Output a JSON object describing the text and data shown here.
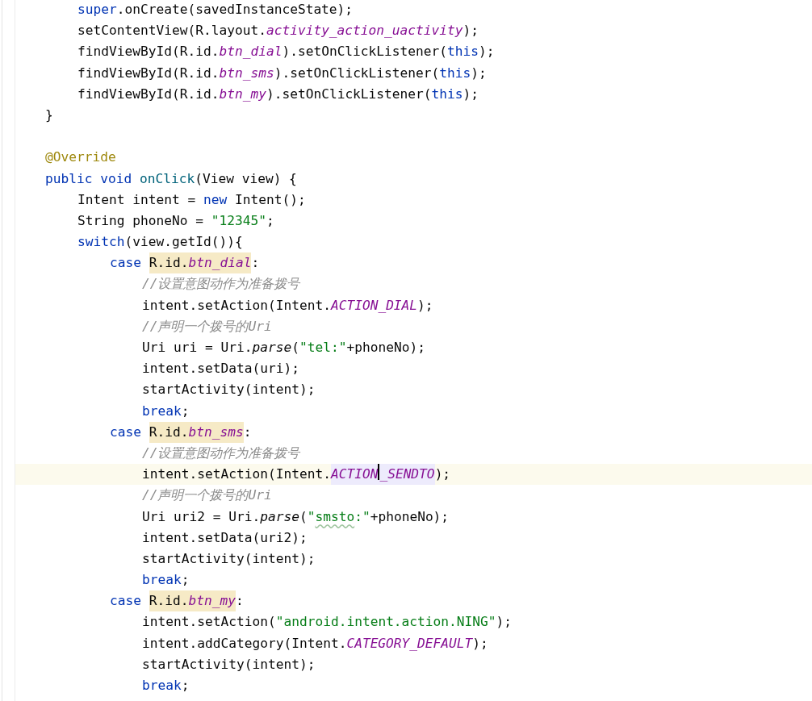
{
  "editor": {
    "lines": [
      {
        "children": [
          {
            "current": false,
            "tokens": [
              {
                "kind": "keyword",
                "text": "super"
              },
              {
                "kind": "plain",
                "text": ".onCreate(savedInstanceState);"
              }
            ]
          },
          {
            "current": false,
            "tokens": [
              {
                "kind": "plain",
                "text": "setContentView(R.layout."
              },
              {
                "kind": "constant",
                "text": "activity_action_uactivity"
              },
              {
                "kind": "plain",
                "text": ");"
              }
            ]
          },
          {
            "current": false,
            "tokens": [
              {
                "kind": "plain",
                "text": "findViewById(R.id."
              },
              {
                "kind": "constant",
                "text": "btn_dial"
              },
              {
                "kind": "plain",
                "text": ").setOnClickListener("
              },
              {
                "kind": "keyword",
                "text": "this"
              },
              {
                "kind": "plain",
                "text": ");"
              }
            ]
          },
          {
            "current": false,
            "tokens": [
              {
                "kind": "plain",
                "text": "findViewById(R.id."
              },
              {
                "kind": "constant",
                "text": "btn_sms"
              },
              {
                "kind": "plain",
                "text": ").setOnClickListener("
              },
              {
                "kind": "keyword",
                "text": "this"
              },
              {
                "kind": "plain",
                "text": ");"
              }
            ]
          },
          {
            "current": false,
            "tokens": [
              {
                "kind": "plain",
                "text": "findViewById(R.id."
              },
              {
                "kind": "constant",
                "text": "btn_my"
              },
              {
                "kind": "plain",
                "text": ").setOnClickListener("
              },
              {
                "kind": "keyword",
                "text": "this"
              },
              {
                "kind": "plain",
                "text": ");"
              }
            ]
          }
        ]
      },
      {
        "current": false,
        "tokens": [
          {
            "kind": "plain",
            "text": "}"
          }
        ]
      },
      {
        "current": false
      },
      {
        "current": false,
        "tokens": [
          {
            "kind": "annotation",
            "text": "@Override"
          }
        ]
      },
      {
        "current": false,
        "tokens": [
          {
            "kind": "keyword",
            "text": "public void"
          },
          {
            "kind": "method",
            "text": " onClick"
          },
          {
            "kind": "plain",
            "text": "(View view) {"
          }
        ],
        "children": [
          {
            "current": false,
            "tokens": [
              {
                "kind": "plain",
                "text": "Intent intent = "
              },
              {
                "kind": "keyword",
                "text": "new"
              },
              {
                "kind": "plain",
                "text": " Intent();"
              }
            ]
          },
          {
            "current": false,
            "tokens": [
              {
                "kind": "plain",
                "text": "String phoneNo = "
              },
              {
                "kind": "string",
                "text": "\"12345\""
              },
              {
                "kind": "plain",
                "text": ";"
              }
            ]
          },
          {
            "current": false,
            "tokens": [
              {
                "kind": "keyword",
                "text": "switch"
              },
              {
                "kind": "plain",
                "text": "(view.getId()){"
              }
            ],
            "children": [
              {
                "current": false,
                "tokens": [
                  {
                    "kind": "keyword",
                    "text": "case"
                  },
                  {
                    "kind": "usage",
                    "tokens": [
                      {
                        "kind": "plain",
                        "text": "R.id."
                      },
                      {
                        "kind": "constant",
                        "text": "btn_dial"
                      }
                    ]
                  },
                  {
                    "kind": "plain",
                    "text": ":"
                  }
                ],
                "children": [
                  {
                    "current": false,
                    "tokens": [
                      {
                        "kind": "comment",
                        "text": "//设置意图动作为准备拨号"
                      }
                    ]
                  },
                  {
                    "current": false,
                    "tokens": [
                      {
                        "kind": "plain",
                        "text": "intent.setAction(Intent."
                      },
                      {
                        "kind": "constant",
                        "text": "ACTION_DIAL"
                      },
                      {
                        "kind": "plain",
                        "text": ");"
                      }
                    ]
                  },
                  {
                    "current": false,
                    "tokens": [
                      {
                        "kind": "comment",
                        "text": "//声明一个拨号的Uri"
                      }
                    ]
                  },
                  {
                    "current": false,
                    "tokens": [
                      {
                        "kind": "plain",
                        "text": "Uri uri = Uri."
                      },
                      {
                        "kind": "static",
                        "text": "parse"
                      },
                      {
                        "kind": "plain",
                        "text": "("
                      },
                      {
                        "kind": "string",
                        "text": "\"tel:\""
                      },
                      {
                        "kind": "plain",
                        "text": "+phoneNo);"
                      }
                    ]
                  },
                  {
                    "current": false,
                    "tokens": [
                      {
                        "kind": "plain",
                        "text": "intent.setData(uri);"
                      }
                    ]
                  },
                  {
                    "current": false,
                    "tokens": [
                      {
                        "kind": "plain",
                        "text": "startActivity(intent);"
                      }
                    ]
                  },
                  {
                    "current": false,
                    "tokens": [
                      {
                        "kind": "keyword",
                        "text": "break"
                      },
                      {
                        "kind": "plain",
                        "text": ";"
                      }
                    ]
                  }
                ]
              },
              {
                "current": false,
                "tokens": [
                  {
                    "kind": "keyword",
                    "text": "case"
                  },
                  {
                    "kind": "usage",
                    "tokens": [
                      {
                        "kind": "plain",
                        "text": "R.id."
                      },
                      {
                        "kind": "constant",
                        "text": "btn_sms"
                      }
                    ]
                  },
                  {
                    "kind": "plain",
                    "text": ":"
                  }
                ],
                "children": [
                  {
                    "current": false,
                    "tokens": [
                      {
                        "kind": "comment",
                        "text": "//设置意图动作为准备拨号"
                      }
                    ]
                  },
                  {
                    "current": true,
                    "tokens": [
                      {
                        "kind": "plain",
                        "text": "intent.setAction(Intent."
                      },
                      {
                        "kind": "selection",
                        "tokens": [
                          {
                            "kind": "constant",
                            "text": "ACTION"
                          },
                          {
                            "kind": "caret"
                          },
                          {
                            "kind": "constant",
                            "text": "_SENDTO"
                          }
                        ]
                      },
                      {
                        "kind": "plain",
                        "text": ");"
                      }
                    ]
                  },
                  {
                    "current": false,
                    "tokens": [
                      {
                        "kind": "comment",
                        "text": "//声明一个拨号的Uri"
                      }
                    ]
                  },
                  {
                    "current": false,
                    "tokens": [
                      {
                        "kind": "plain",
                        "text": "Uri uri2 = Uri."
                      },
                      {
                        "kind": "static",
                        "text": "parse"
                      },
                      {
                        "kind": "plain",
                        "text": "("
                      },
                      {
                        "kind": "string",
                        "text": "\""
                      },
                      {
                        "kind": "misspelled",
                        "text": "smsto"
                      },
                      {
                        "kind": "string",
                        "text": ":\""
                      },
                      {
                        "kind": "plain",
                        "text": "+phoneNo);"
                      }
                    ]
                  },
                  {
                    "current": false,
                    "tokens": [
                      {
                        "kind": "plain",
                        "text": "intent.setData(uri2);"
                      }
                    ]
                  },
                  {
                    "current": false,
                    "tokens": [
                      {
                        "kind": "plain",
                        "text": "startActivity(intent);"
                      }
                    ]
                  },
                  {
                    "current": false,
                    "tokens": [
                      {
                        "kind": "keyword",
                        "text": "break"
                      },
                      {
                        "kind": "plain",
                        "text": ";"
                      }
                    ]
                  }
                ]
              },
              {
                "current": false,
                "tokens": [
                  {
                    "kind": "keyword",
                    "text": "case"
                  },
                  {
                    "kind": "usage",
                    "tokens": [
                      {
                        "kind": "plain",
                        "text": "R.id."
                      },
                      {
                        "kind": "constant",
                        "text": "btn_my"
                      }
                    ]
                  },
                  {
                    "kind": "plain",
                    "text": ":"
                  }
                ],
                "children": [
                  {
                    "current": false,
                    "tokens": [
                      {
                        "kind": "plain",
                        "text": "intent.setAction("
                      },
                      {
                        "kind": "string",
                        "text": "\"android.intent.action.NING\""
                      },
                      {
                        "kind": "plain",
                        "text": ");"
                      }
                    ]
                  },
                  {
                    "current": false,
                    "tokens": [
                      {
                        "kind": "plain",
                        "text": "intent.addCategory(Intent."
                      },
                      {
                        "kind": "constant",
                        "text": "CATEGORY_DEFAULT"
                      },
                      {
                        "kind": "plain",
                        "text": ");"
                      }
                    ]
                  },
                  {
                    "current": false,
                    "tokens": [
                      {
                        "kind": "plain",
                        "text": "startActivity(intent);"
                      }
                    ]
                  },
                  {
                    "current": false,
                    "tokens": [
                      {
                        "kind": "keyword",
                        "text": "break"
                      },
                      {
                        "kind": "plain",
                        "text": ";"
                      }
                    ]
                  }
                ]
              }
            ]
          }
        ]
      }
    ]
  }
}
